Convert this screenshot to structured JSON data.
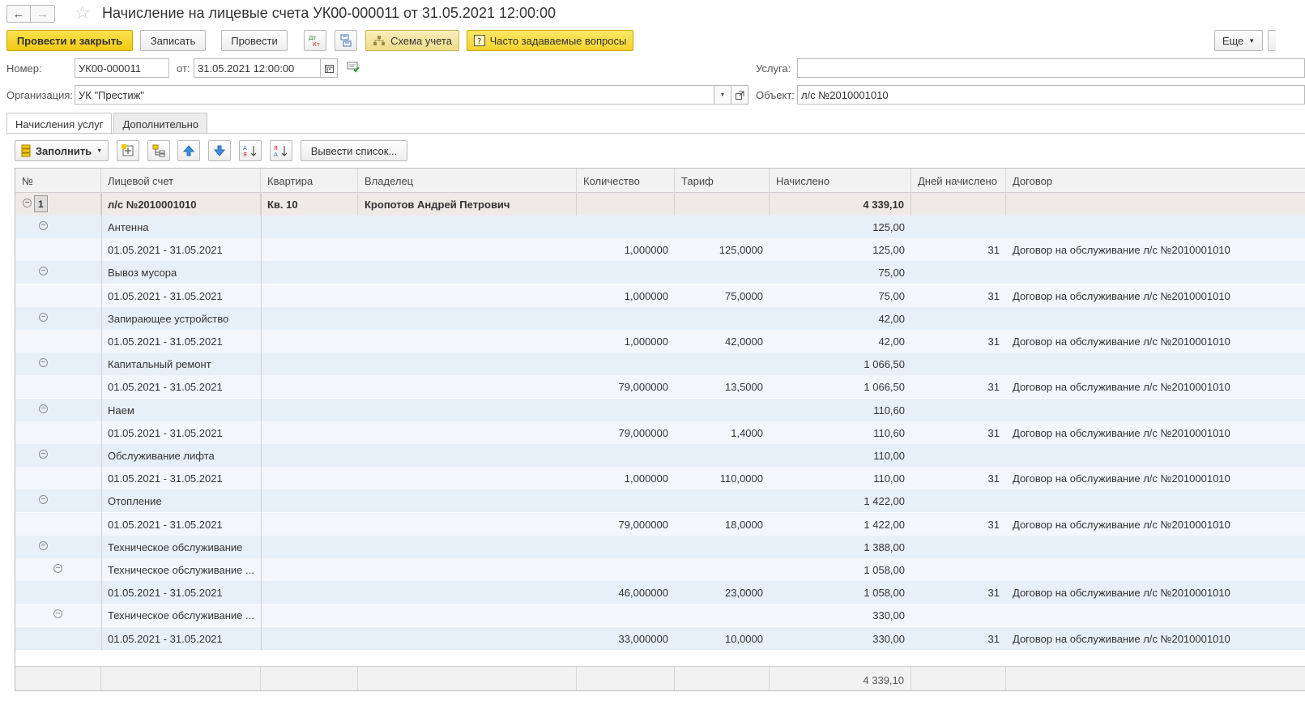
{
  "window": {
    "title": "Начисление на лицевые счета УК00-000011 от 31.05.2021 12:00:00"
  },
  "toolbar": {
    "post_close": "Провести и закрыть",
    "save": "Записать",
    "post": "Провести",
    "scheme": "Схема учета",
    "faq": "Часто задаваемые вопросы",
    "more": "Еще"
  },
  "form": {
    "number_label": "Номер:",
    "number_value": "УК00-000011",
    "date_label": "от:",
    "date_value": "31.05.2021 12:00:00",
    "org_label": "Организация:",
    "org_value": "УК \"Престиж\"",
    "service_label": "Услуга:",
    "service_value": "",
    "object_label": "Объект:",
    "object_value": "л/с №2010001010"
  },
  "tabs": [
    {
      "label": "Начисления услуг",
      "active": true
    },
    {
      "label": "Дополнительно",
      "active": false
    }
  ],
  "grid_toolbar": {
    "fill": "Заполнить",
    "output_list": "Вывести список..."
  },
  "grid": {
    "columns": [
      "№",
      "Лицевой счет",
      "Квартира",
      "Владелец",
      "Количество",
      "Тариф",
      "Начислено",
      "Дней начислено",
      "Договор"
    ],
    "top_row": {
      "no": "1",
      "account": "л/с №2010001010",
      "apartment": "Кв. 10",
      "owner": "Кропотов Андрей Петрович",
      "accrued": "4 339,10"
    },
    "rows": [
      {
        "label": "Антенна",
        "qty": "",
        "tariff": "",
        "accrued": "125,00",
        "days": "",
        "contract": ""
      },
      {
        "label": "01.05.2021 - 31.05.2021",
        "qty": "1,000000",
        "tariff": "125,0000",
        "accrued": "125,00",
        "days": "31",
        "contract": "Договор на обслуживание л/с №2010001010"
      },
      {
        "label": "Вывоз мусора",
        "qty": "",
        "tariff": "",
        "accrued": "75,00",
        "days": "",
        "contract": ""
      },
      {
        "label": "01.05.2021 - 31.05.2021",
        "qty": "1,000000",
        "tariff": "75,0000",
        "accrued": "75,00",
        "days": "31",
        "contract": "Договор на обслуживание л/с №2010001010"
      },
      {
        "label": "Запирающее устройство",
        "qty": "",
        "tariff": "",
        "accrued": "42,00",
        "days": "",
        "contract": ""
      },
      {
        "label": "01.05.2021 - 31.05.2021",
        "qty": "1,000000",
        "tariff": "42,0000",
        "accrued": "42,00",
        "days": "31",
        "contract": "Договор на обслуживание л/с №2010001010"
      },
      {
        "label": "Капитальный ремонт",
        "qty": "",
        "tariff": "",
        "accrued": "1 066,50",
        "days": "",
        "contract": ""
      },
      {
        "label": "01.05.2021 - 31.05.2021",
        "qty": "79,000000",
        "tariff": "13,5000",
        "accrued": "1 066,50",
        "days": "31",
        "contract": "Договор на обслуживание л/с №2010001010"
      },
      {
        "label": "Наем",
        "qty": "",
        "tariff": "",
        "accrued": "110,60",
        "days": "",
        "contract": ""
      },
      {
        "label": "01.05.2021 - 31.05.2021",
        "qty": "79,000000",
        "tariff": "1,4000",
        "accrued": "110,60",
        "days": "31",
        "contract": "Договор на обслуживание л/с №2010001010"
      },
      {
        "label": "Обслуживание лифта",
        "qty": "",
        "tariff": "",
        "accrued": "110,00",
        "days": "",
        "contract": ""
      },
      {
        "label": "01.05.2021 - 31.05.2021",
        "qty": "1,000000",
        "tariff": "110,0000",
        "accrued": "110,00",
        "days": "31",
        "contract": "Договор на обслуживание л/с №2010001010"
      },
      {
        "label": "Отопление",
        "qty": "",
        "tariff": "",
        "accrued": "1 422,00",
        "days": "",
        "contract": ""
      },
      {
        "label": "01.05.2021 - 31.05.2021",
        "qty": "79,000000",
        "tariff": "18,0000",
        "accrued": "1 422,00",
        "days": "31",
        "contract": "Договор на обслуживание л/с №2010001010"
      },
      {
        "label": "Техническое обслуживание",
        "qty": "",
        "tariff": "",
        "accrued": "1 388,00",
        "days": "",
        "contract": ""
      },
      {
        "label": "Техническое обслуживание ...",
        "qty": "",
        "tariff": "",
        "accrued": "1 058,00",
        "days": "",
        "contract": ""
      },
      {
        "label": "01.05.2021 - 31.05.2021",
        "qty": "46,000000",
        "tariff": "23,0000",
        "accrued": "1 058,00",
        "days": "31",
        "contract": "Договор на обслуживание л/с №2010001010"
      },
      {
        "label": "Техническое обслуживание ...",
        "qty": "",
        "tariff": "",
        "accrued": "330,00",
        "days": "",
        "contract": ""
      },
      {
        "label": "01.05.2021 - 31.05.2021",
        "qty": "33,000000",
        "tariff": "10,0000",
        "accrued": "330,00",
        "days": "31",
        "contract": "Договор на обслуживание л/с №2010001010"
      }
    ],
    "footer_total": "4 339,10"
  }
}
